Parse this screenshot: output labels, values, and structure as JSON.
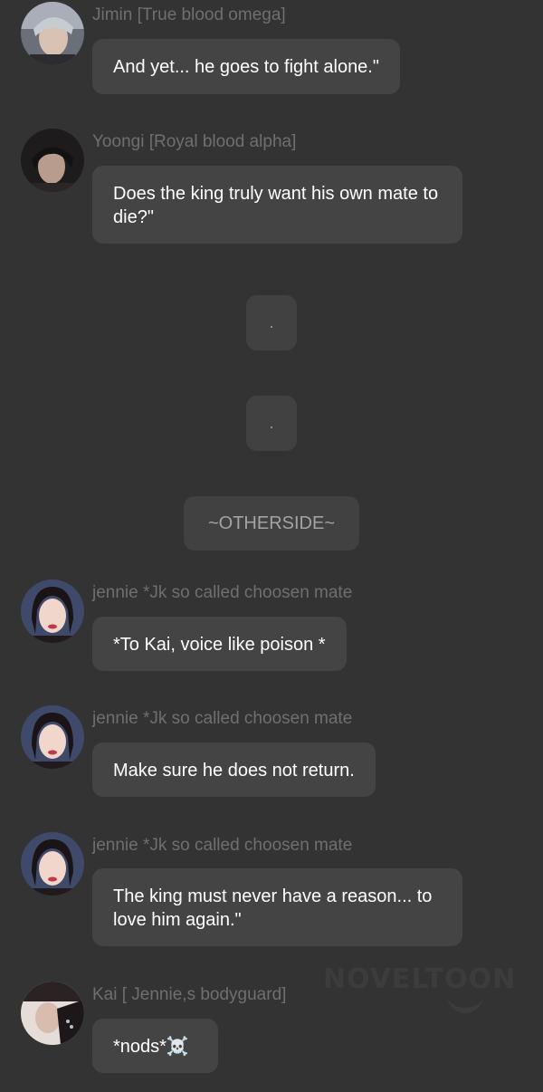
{
  "messages": [
    {
      "name": "Jimin [True blood omega]",
      "text": "And yet... he goes to fight alone.\"",
      "avatar_icon": "jimin-avatar"
    },
    {
      "name": "Yoongi [Royal blood alpha]",
      "text": "Does the king truly want his own mate to die?\"",
      "avatar_icon": "yoongi-avatar"
    },
    {
      "name": "jennie *Jk so called choosen mate",
      "text": "*To Kai, voice like poison *",
      "avatar_icon": "jennie-avatar"
    },
    {
      "name": "jennie *Jk so called choosen mate",
      "text": "Make sure he does not return.",
      "avatar_icon": "jennie-avatar"
    },
    {
      "name": "jennie *Jk so called choosen mate",
      "text": "The king must never have a reason... to love him again.\"",
      "avatar_icon": "jennie-avatar"
    },
    {
      "name": "Kai [ Jennie,s bodyguard]",
      "text": "*nods*☠️",
      "avatar_icon": "kai-avatar"
    }
  ],
  "separators": [
    ".",
    ".",
    "~OTHERSIDE~"
  ],
  "watermark": "NOVELTOON",
  "colors": {
    "background": "#333333",
    "bubble": "#444444",
    "name_text": "#6f6f6f",
    "message_text": "#ffffff"
  }
}
